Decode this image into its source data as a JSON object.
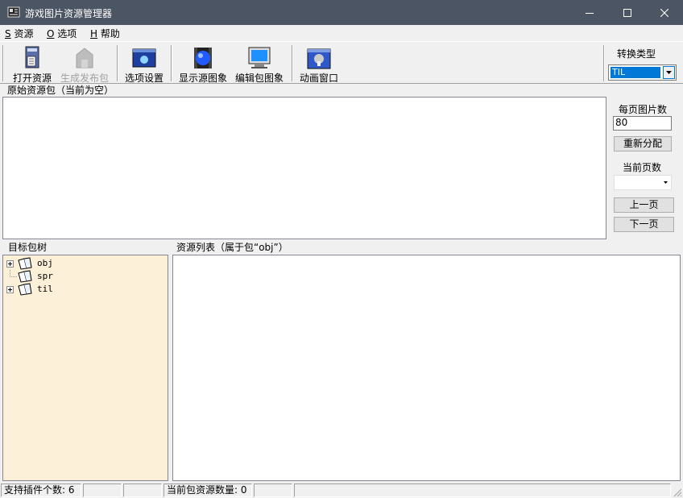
{
  "window": {
    "title": "游戏图片资源管理器"
  },
  "menu": [
    {
      "key": "S",
      "label": "资源"
    },
    {
      "key": "O",
      "label": "选项"
    },
    {
      "key": "H",
      "label": "帮助"
    }
  ],
  "toolbar": {
    "open": "打开资源",
    "publish": "生成发布包",
    "options": "选项设置",
    "show_source": "显示源图象",
    "edit_image": "编辑包图象",
    "animation": "动画窗口",
    "convert_label": "转换类型",
    "convert_value": "TIL"
  },
  "source_group": {
    "label": "原始资源包（当前为空）"
  },
  "side": {
    "per_page_label": "每页图片数",
    "per_page_value": "80",
    "redistribute": "重新分配",
    "current_page_label": "当前页数",
    "current_page_value": "",
    "prev": "上一页",
    "next": "下一页"
  },
  "tree_group": {
    "label": "目标包树",
    "items": [
      {
        "label": "obj",
        "expandable": true
      },
      {
        "label": "spr",
        "expandable": false
      },
      {
        "label": "til",
        "expandable": true
      }
    ]
  },
  "list_group": {
    "label": "资源列表（属于包“obj”）"
  },
  "status": {
    "plugins": "支持插件个数: 6",
    "count": "当前包资源数量: 0"
  },
  "colors": {
    "titlebar": "#4b5563",
    "tree_bg": "#fdf0d9",
    "selection": "#0078d7"
  }
}
